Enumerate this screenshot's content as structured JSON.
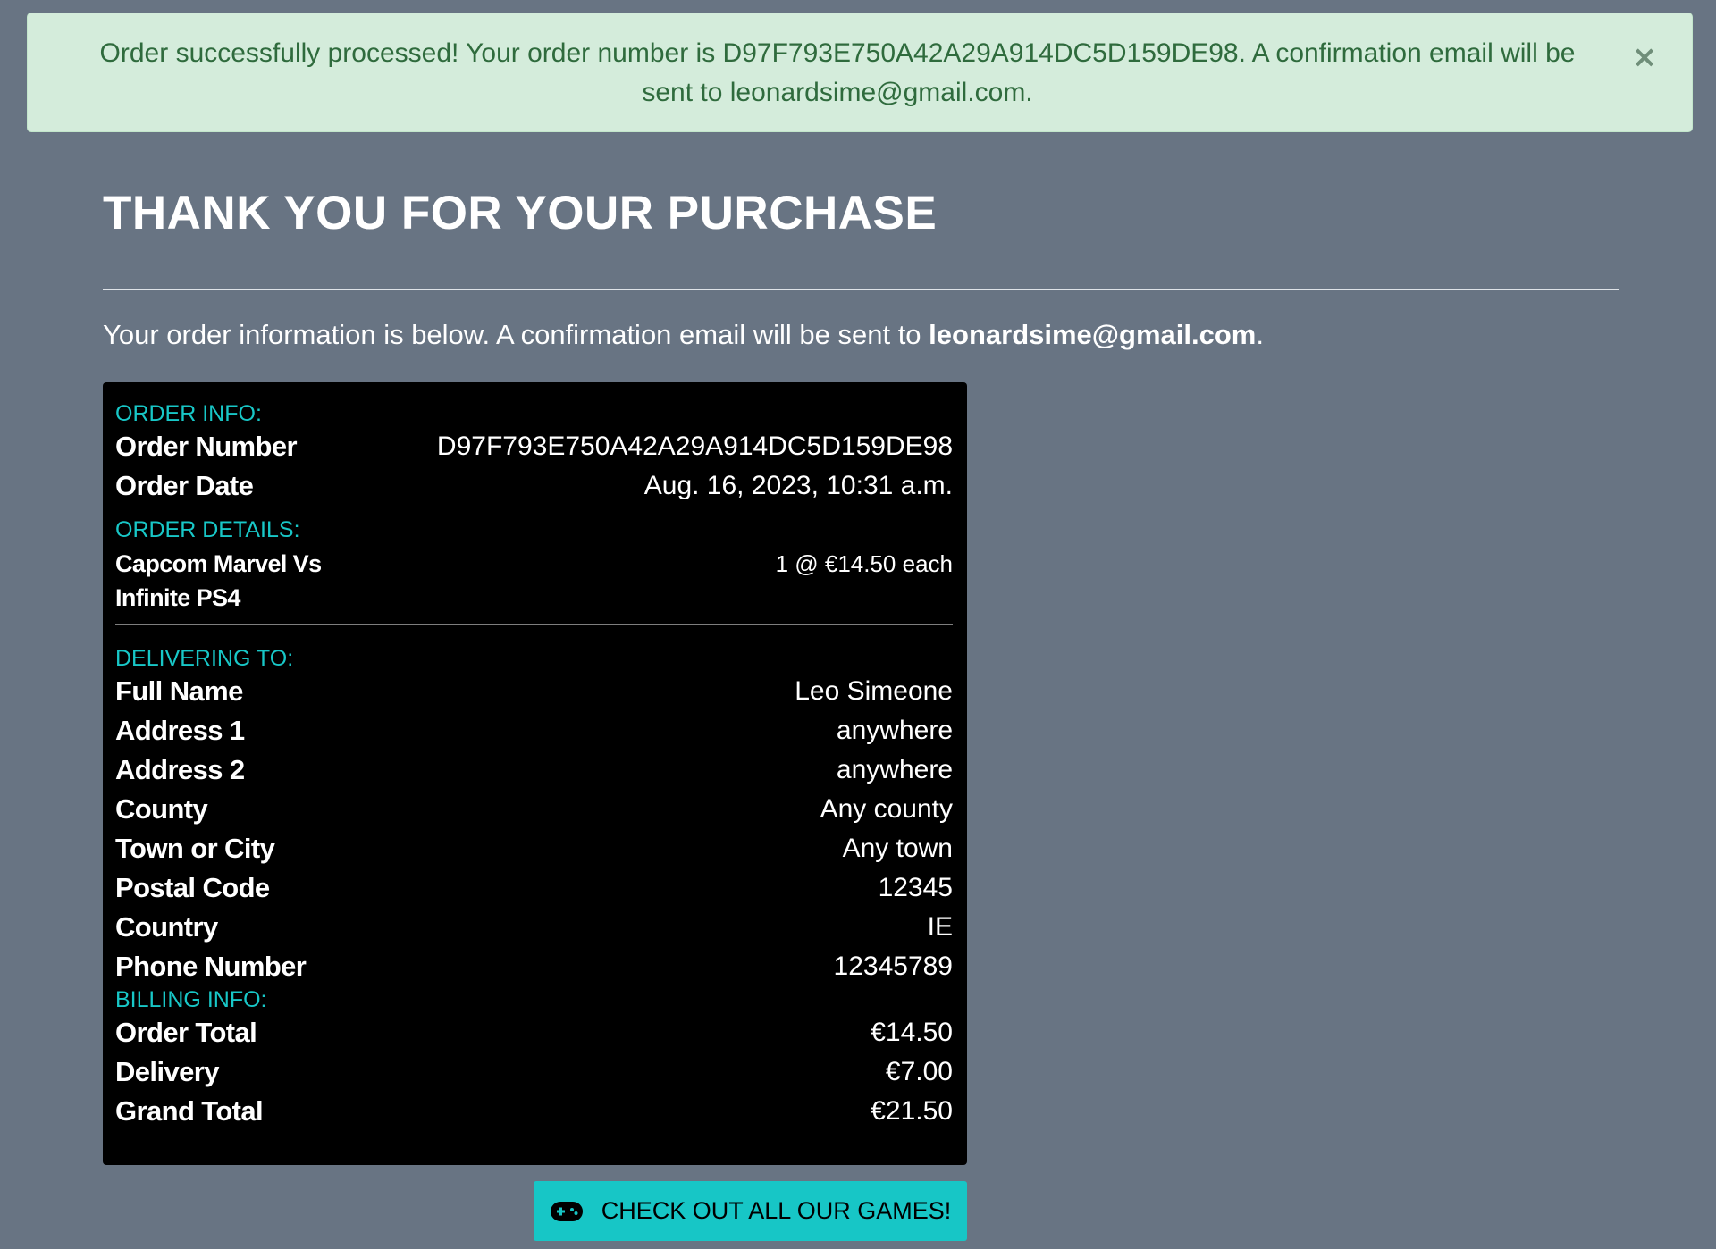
{
  "alert": {
    "message": "Order successfully processed! Your order number is D97F793E750A42A29A914DC5D159DE98. A confirmation email will be sent to leonardsime@gmail.com.",
    "close_symbol": "×",
    "color": "#d4ecdb"
  },
  "page": {
    "title": "THANK YOU FOR YOUR PURCHASE",
    "intro_prefix": "Your order information is below. A confirmation email will be sent to ",
    "intro_email": "leonardsime@gmail.com",
    "intro_suffix": ".",
    "background": "#687483"
  },
  "order_info": {
    "heading": "Order Info:",
    "rows": [
      {
        "label": "Order Number",
        "value": "D97F793E750A42A29A914DC5D159DE98"
      },
      {
        "label": "Order Date",
        "value": "Aug. 16, 2023, 10:31 a.m."
      }
    ]
  },
  "order_details": {
    "heading": "Order Details:",
    "items": [
      {
        "name": "Capcom Marvel Vs Infinite PS4",
        "quantity_price": "1 @ €14.50 each"
      }
    ]
  },
  "delivering_to": {
    "heading": "Delivering To:",
    "rows": [
      {
        "label": "Full Name",
        "value": "Leo Simeone"
      },
      {
        "label": "Address 1",
        "value": "anywhere"
      },
      {
        "label": "Address 2",
        "value": "anywhere"
      },
      {
        "label": "County",
        "value": "Any county"
      },
      {
        "label": "Town or City",
        "value": "Any town"
      },
      {
        "label": "Postal Code",
        "value": "12345"
      },
      {
        "label": "Country",
        "value": "IE"
      },
      {
        "label": "Phone Number",
        "value": "12345789"
      }
    ]
  },
  "billing_info": {
    "heading": "Billing Info:",
    "rows": [
      {
        "label": "Order Total",
        "value": "€14.50"
      },
      {
        "label": "Delivery",
        "value": "€7.00"
      },
      {
        "label": "Grand Total",
        "value": "€21.50"
      }
    ]
  },
  "cta": {
    "label": "Check out all our games!",
    "icon": "gamepad-icon",
    "color": "#17c6c6"
  },
  "accent_color": "#18c7c7"
}
